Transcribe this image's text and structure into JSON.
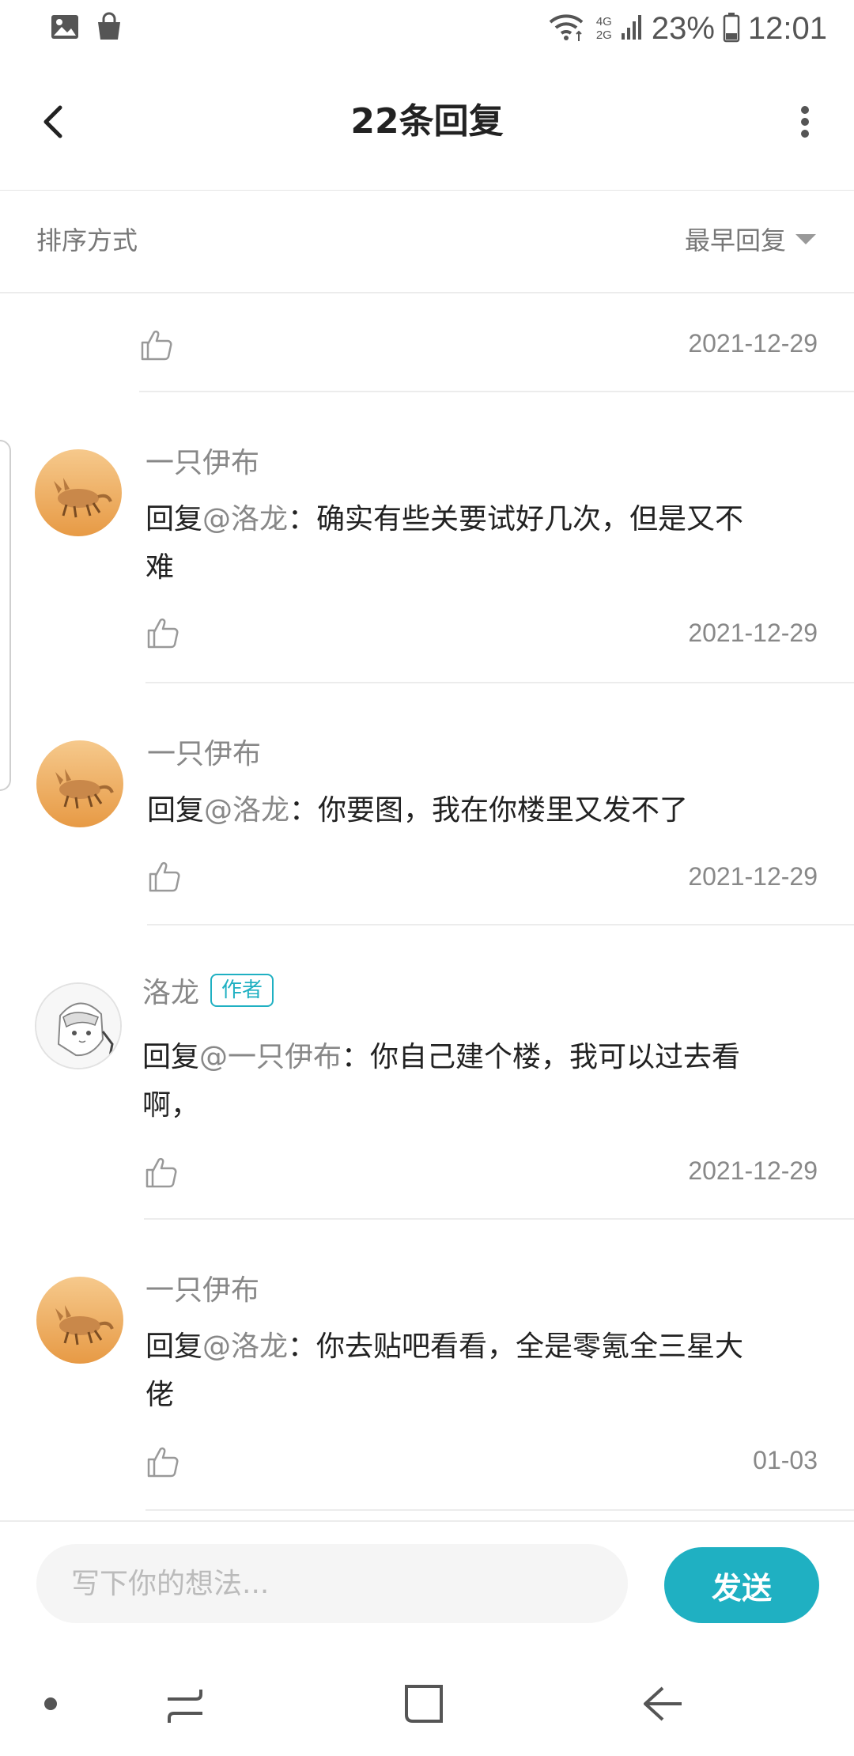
{
  "status_bar": {
    "network_top": "4G",
    "network_bottom": "2G",
    "battery": "23%",
    "time": "12:01"
  },
  "header": {
    "title": "22条回复"
  },
  "sort_bar": {
    "label": "排序方式",
    "value": "最早回复"
  },
  "partial_comment": {
    "date": "2021-12-29"
  },
  "comments": [
    {
      "username": "一只伊布",
      "badge": "",
      "reply_prefix": "回复",
      "mention": "@洛龙",
      "text_line1": "：确实有些关要试好几次，但是又不",
      "text_line2": "难",
      "date": "2021-12-29",
      "avatar": "fennec-fox"
    },
    {
      "username": "一只伊布",
      "badge": "",
      "reply_prefix": "回复",
      "mention": "@洛龙",
      "text_line1": "：你要图，我在你楼里又发不了",
      "text_line2": "",
      "date": "2021-12-29",
      "avatar": "fennec-fox"
    },
    {
      "username": "洛龙",
      "badge": "作者",
      "reply_prefix": "回复",
      "mention": "@一只伊布",
      "text_line1": "：你自己建个楼，我可以过去看",
      "text_line2": "啊，",
      "date": "2021-12-29",
      "avatar": "anime-character"
    },
    {
      "username": "一只伊布",
      "badge": "",
      "reply_prefix": "回复",
      "mention": "@洛龙",
      "text_line1": "：你去贴吧看看，全是零氪全三星大",
      "text_line2": "佬",
      "date": "01-03",
      "avatar": "fennec-fox"
    }
  ],
  "input_bar": {
    "placeholder": "写下你的想法...",
    "send_label": "发送"
  },
  "colors": {
    "accent": "#1fb0c2",
    "muted_text": "#888888",
    "divider": "#ececec"
  },
  "icons": [
    "gallery-icon",
    "shopping-bag-icon",
    "wifi-icon",
    "signal-icon",
    "battery-icon",
    "back-arrow-icon",
    "more-vertical-icon",
    "dropdown-triangle-icon",
    "thumbs-up-icon",
    "recent-apps-icon",
    "home-icon",
    "nav-back-icon"
  ]
}
